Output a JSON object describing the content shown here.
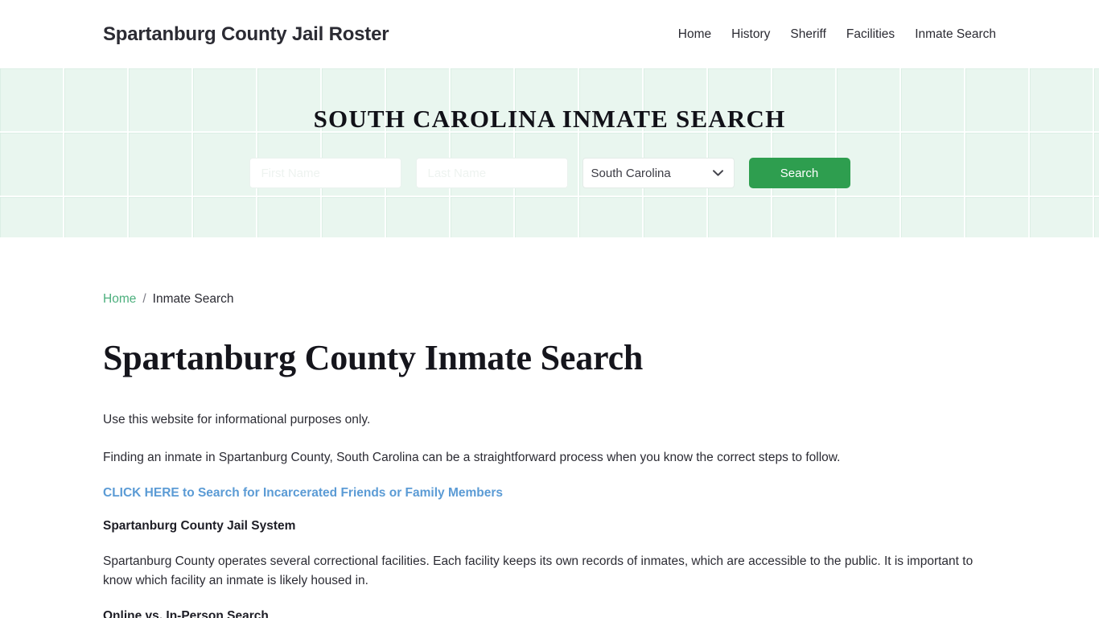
{
  "header": {
    "brand": "Spartanburg County Jail Roster",
    "nav": [
      {
        "label": "Home"
      },
      {
        "label": "History"
      },
      {
        "label": "Sheriff"
      },
      {
        "label": "Facilities"
      },
      {
        "label": "Inmate Search"
      }
    ]
  },
  "hero": {
    "title": "SOUTH CAROLINA INMATE SEARCH",
    "first_name": {
      "value": "",
      "placeholder": "First Name"
    },
    "last_name": {
      "value": "",
      "placeholder": "Last Name"
    },
    "state_select": {
      "selected": "South Carolina",
      "options": [
        "South Carolina"
      ]
    },
    "search_button": "Search",
    "accent_green": "#2e9e4f",
    "background": "#e9f6ef"
  },
  "breadcrumb": {
    "home": "Home",
    "separator": "/",
    "current": "Inmate Search"
  },
  "main": {
    "title": "Spartanburg County Inmate Search",
    "paragraph_1": "Use this website for informational purposes only.",
    "paragraph_2": "Finding an inmate in Spartanburg County, South Carolina can be a straightforward process when you know the correct steps to follow.",
    "cta_link": "CLICK HERE to Search for Incarcerated Friends or Family Members",
    "cta_color": "#5b9bd5",
    "heading_1": "Spartanburg County Jail System",
    "paragraph_3": "Spartanburg County operates several correctional facilities. Each facility keeps its own records of inmates, which are accessible to the public. It is important to know which facility an inmate is likely housed in.",
    "heading_2": "Online vs. In-Person Search"
  }
}
